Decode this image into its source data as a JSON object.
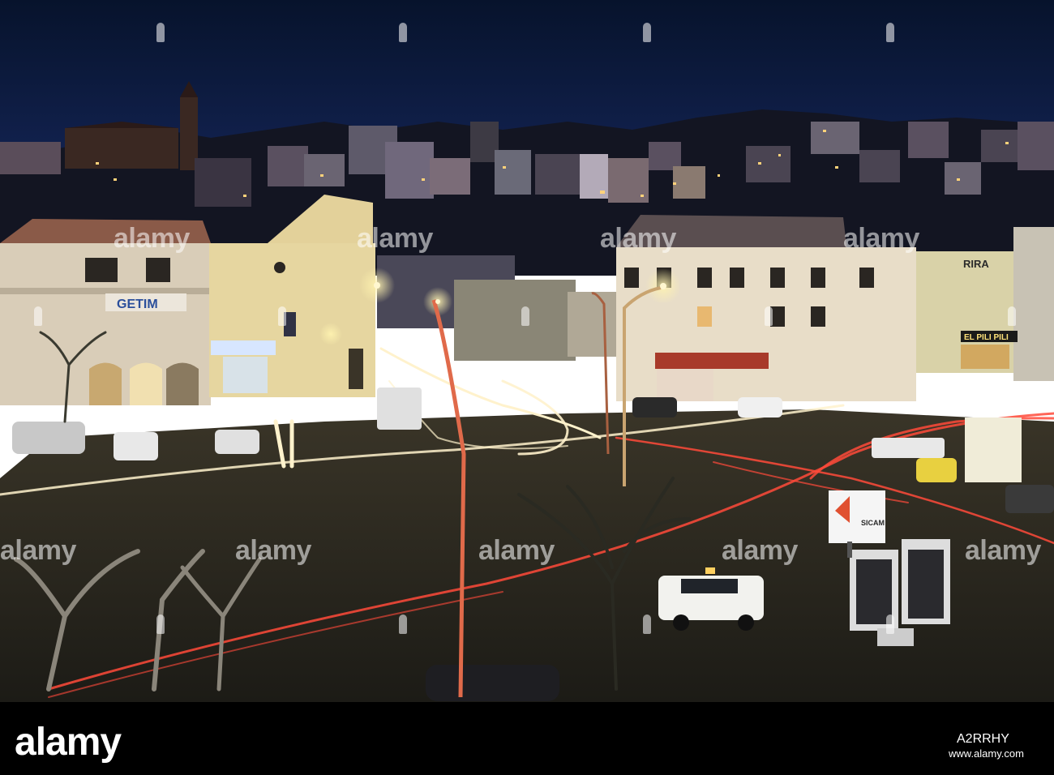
{
  "photo": {
    "subject": "night-city-square",
    "colors": {
      "sky": "#0c1a3a",
      "road": "#2c2a22",
      "trail_white": "#fff4d8",
      "trail_red": "#ff4a3a",
      "building_light": "#e9dcc4",
      "lamp": "#ffe9a0"
    },
    "signs": {
      "getim": "GETIM",
      "rira": "RIRA",
      "elpilipili": "EL PILI PILI",
      "sicam": "SICAM"
    }
  },
  "watermark": {
    "text": "alamy"
  },
  "footer": {
    "logo": "alamy",
    "image_id": "A2RRHY",
    "url": "www.alamy.com"
  }
}
